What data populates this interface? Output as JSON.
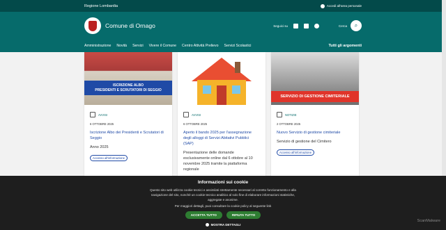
{
  "topbar": {
    "region": "Regione Lombardia",
    "login": "Accedi all'area personale"
  },
  "header": {
    "brand": "Comune di Ornago",
    "social_label": "Seguici su",
    "search_label": "Cerca"
  },
  "nav": {
    "items": [
      "Amministrazione",
      "Novità",
      "Servizi",
      "Vivere il Comune",
      "Centro Attività Prelievo",
      "Servizi Scolastici"
    ],
    "all": "Tutti gli argomenti"
  },
  "cards": [
    {
      "banner": "ISCRIZIONE ALBO\nPRESIDENTI E SCRUTATORI DI SEGGIO",
      "category": "AVVISI",
      "date": "6 OTTOBRE 2025",
      "title": "Iscrizione Albo dei Presidenti e Scrutatori di Seggio",
      "desc": "Anno 2025",
      "tag": "Accesso all'informazione"
    },
    {
      "banner": "",
      "category": "AVVISI",
      "date": "6 OTTOBRE 2025",
      "title": "Aperto il bando 2025 per l'assegnazione degli alloggi di Servizi Abitativi Pubblici (SAP)",
      "desc": "Presentazione delle domande esclusivamente online dal 6 ottobre al 10 novembre 2025 tramite la piattaforma regionale",
      "tag": ""
    },
    {
      "banner": "SERVIZIO DI GESTIONE CIMITERIALE",
      "category": "NOTIZIE",
      "date": "2 OTTOBRE 2025",
      "title": "Nuovo Servizio di gestione cimiteriale",
      "desc": "Servizio di gestione del Cimitero",
      "tag": "Accesso all'informazione"
    }
  ],
  "cookie": {
    "title": "Informazioni sui cookie",
    "text1": "Questo sito web utilizza cookie tecnici e assimilati strettamente necessari al corretto funzionamento e alla navigazione del sito, nonché un cookie tecnico analitico al solo fine di elaborare informazioni statistiche, aggregate e anonime.",
    "text2": "Per maggiori dettagli, puoi consultare la cookie policy al seguente link",
    "accept": "ACCETTA TUTTO",
    "reject": "RIFIUTA TUTTO",
    "more": "MOSTRA DETTAGLI"
  },
  "watermark": "ScanMalware"
}
